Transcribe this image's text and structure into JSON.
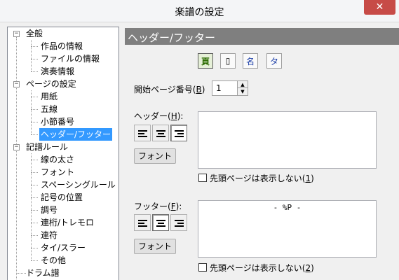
{
  "window": {
    "title": "楽譜の設定",
    "close_label": "✕"
  },
  "tree": {
    "items": [
      {
        "label": "全般",
        "toggle": "−"
      },
      {
        "label": "作品の情報"
      },
      {
        "label": "ファイルの情報"
      },
      {
        "label": "演奏情報"
      },
      {
        "label": "ページの設定",
        "toggle": "−"
      },
      {
        "label": "用紙"
      },
      {
        "label": "五線"
      },
      {
        "label": "小節番号"
      },
      {
        "label": "ヘッダー/フッター",
        "selected": true
      },
      {
        "label": "記譜ルール",
        "toggle": "−"
      },
      {
        "label": "線の太さ"
      },
      {
        "label": "フォント"
      },
      {
        "label": "スペーシングルール"
      },
      {
        "label": "記号の位置"
      },
      {
        "label": "調号"
      },
      {
        "label": "連桁/トレモロ"
      },
      {
        "label": "連符"
      },
      {
        "label": "タイ/スラー"
      },
      {
        "label": "その他"
      },
      {
        "label": "ドラム譜"
      }
    ]
  },
  "panel": {
    "title": "ヘッダー/フッター",
    "tool_icons": [
      {
        "name": "page-number-icon",
        "glyph": "頁"
      },
      {
        "name": "pages-icon",
        "glyph": "▯"
      },
      {
        "name": "name-icon",
        "glyph": "名"
      },
      {
        "name": "title-icon",
        "glyph": "タ"
      }
    ],
    "start_page": {
      "label": "開始ページ番号(",
      "accel": "B",
      "suffix": ")",
      "value": "1"
    },
    "header": {
      "label": "ヘッダー(",
      "accel": "H",
      "suffix": "):",
      "font_button": "フォント",
      "content": "",
      "checkbox_label": "先頭ページは表示しない(",
      "checkbox_accel": "1",
      "checkbox_suffix": ")",
      "align": "right"
    },
    "footer": {
      "label": "フッター(",
      "accel": "F",
      "suffix": "):",
      "font_button": "フォント",
      "content": "- %P -",
      "checkbox_label": "先頭ページは表示しない(",
      "checkbox_accel": "2",
      "checkbox_suffix": ")",
      "align": "center"
    }
  }
}
